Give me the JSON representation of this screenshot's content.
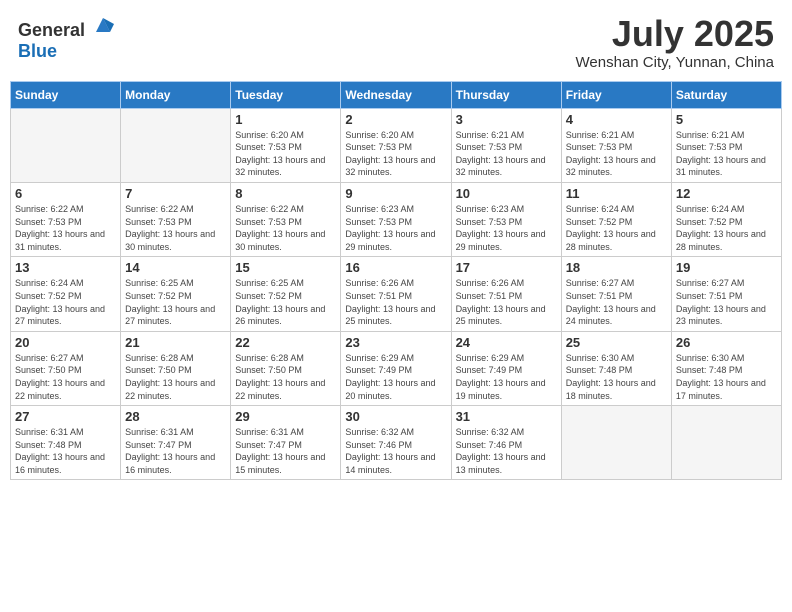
{
  "header": {
    "logo_general": "General",
    "logo_blue": "Blue",
    "month_title": "July 2025",
    "location": "Wenshan City, Yunnan, China"
  },
  "days_of_week": [
    "Sunday",
    "Monday",
    "Tuesday",
    "Wednesday",
    "Thursday",
    "Friday",
    "Saturday"
  ],
  "weeks": [
    [
      {
        "day": "",
        "info": ""
      },
      {
        "day": "",
        "info": ""
      },
      {
        "day": "1",
        "info": "Sunrise: 6:20 AM\nSunset: 7:53 PM\nDaylight: 13 hours and 32 minutes."
      },
      {
        "day": "2",
        "info": "Sunrise: 6:20 AM\nSunset: 7:53 PM\nDaylight: 13 hours and 32 minutes."
      },
      {
        "day": "3",
        "info": "Sunrise: 6:21 AM\nSunset: 7:53 PM\nDaylight: 13 hours and 32 minutes."
      },
      {
        "day": "4",
        "info": "Sunrise: 6:21 AM\nSunset: 7:53 PM\nDaylight: 13 hours and 32 minutes."
      },
      {
        "day": "5",
        "info": "Sunrise: 6:21 AM\nSunset: 7:53 PM\nDaylight: 13 hours and 31 minutes."
      }
    ],
    [
      {
        "day": "6",
        "info": "Sunrise: 6:22 AM\nSunset: 7:53 PM\nDaylight: 13 hours and 31 minutes."
      },
      {
        "day": "7",
        "info": "Sunrise: 6:22 AM\nSunset: 7:53 PM\nDaylight: 13 hours and 30 minutes."
      },
      {
        "day": "8",
        "info": "Sunrise: 6:22 AM\nSunset: 7:53 PM\nDaylight: 13 hours and 30 minutes."
      },
      {
        "day": "9",
        "info": "Sunrise: 6:23 AM\nSunset: 7:53 PM\nDaylight: 13 hours and 29 minutes."
      },
      {
        "day": "10",
        "info": "Sunrise: 6:23 AM\nSunset: 7:53 PM\nDaylight: 13 hours and 29 minutes."
      },
      {
        "day": "11",
        "info": "Sunrise: 6:24 AM\nSunset: 7:52 PM\nDaylight: 13 hours and 28 minutes."
      },
      {
        "day": "12",
        "info": "Sunrise: 6:24 AM\nSunset: 7:52 PM\nDaylight: 13 hours and 28 minutes."
      }
    ],
    [
      {
        "day": "13",
        "info": "Sunrise: 6:24 AM\nSunset: 7:52 PM\nDaylight: 13 hours and 27 minutes."
      },
      {
        "day": "14",
        "info": "Sunrise: 6:25 AM\nSunset: 7:52 PM\nDaylight: 13 hours and 27 minutes."
      },
      {
        "day": "15",
        "info": "Sunrise: 6:25 AM\nSunset: 7:52 PM\nDaylight: 13 hours and 26 minutes."
      },
      {
        "day": "16",
        "info": "Sunrise: 6:26 AM\nSunset: 7:51 PM\nDaylight: 13 hours and 25 minutes."
      },
      {
        "day": "17",
        "info": "Sunrise: 6:26 AM\nSunset: 7:51 PM\nDaylight: 13 hours and 25 minutes."
      },
      {
        "day": "18",
        "info": "Sunrise: 6:27 AM\nSunset: 7:51 PM\nDaylight: 13 hours and 24 minutes."
      },
      {
        "day": "19",
        "info": "Sunrise: 6:27 AM\nSunset: 7:51 PM\nDaylight: 13 hours and 23 minutes."
      }
    ],
    [
      {
        "day": "20",
        "info": "Sunrise: 6:27 AM\nSunset: 7:50 PM\nDaylight: 13 hours and 22 minutes."
      },
      {
        "day": "21",
        "info": "Sunrise: 6:28 AM\nSunset: 7:50 PM\nDaylight: 13 hours and 22 minutes."
      },
      {
        "day": "22",
        "info": "Sunrise: 6:28 AM\nSunset: 7:50 PM\nDaylight: 13 hours and 22 minutes."
      },
      {
        "day": "23",
        "info": "Sunrise: 6:29 AM\nSunset: 7:49 PM\nDaylight: 13 hours and 20 minutes."
      },
      {
        "day": "24",
        "info": "Sunrise: 6:29 AM\nSunset: 7:49 PM\nDaylight: 13 hours and 19 minutes."
      },
      {
        "day": "25",
        "info": "Sunrise: 6:30 AM\nSunset: 7:48 PM\nDaylight: 13 hours and 18 minutes."
      },
      {
        "day": "26",
        "info": "Sunrise: 6:30 AM\nSunset: 7:48 PM\nDaylight: 13 hours and 17 minutes."
      }
    ],
    [
      {
        "day": "27",
        "info": "Sunrise: 6:31 AM\nSunset: 7:48 PM\nDaylight: 13 hours and 16 minutes."
      },
      {
        "day": "28",
        "info": "Sunrise: 6:31 AM\nSunset: 7:47 PM\nDaylight: 13 hours and 16 minutes."
      },
      {
        "day": "29",
        "info": "Sunrise: 6:31 AM\nSunset: 7:47 PM\nDaylight: 13 hours and 15 minutes."
      },
      {
        "day": "30",
        "info": "Sunrise: 6:32 AM\nSunset: 7:46 PM\nDaylight: 13 hours and 14 minutes."
      },
      {
        "day": "31",
        "info": "Sunrise: 6:32 AM\nSunset: 7:46 PM\nDaylight: 13 hours and 13 minutes."
      },
      {
        "day": "",
        "info": ""
      },
      {
        "day": "",
        "info": ""
      }
    ]
  ]
}
